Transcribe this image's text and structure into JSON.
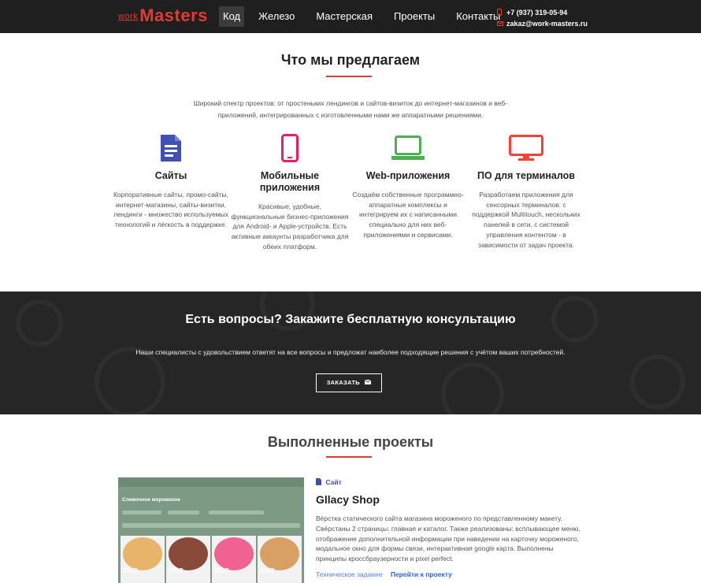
{
  "header": {
    "logo_small": "work",
    "logo_big": "Masters",
    "nav": [
      {
        "label": "Код",
        "active": true
      },
      {
        "label": "Железо"
      },
      {
        "label": "Мастерская"
      },
      {
        "label": "Проекты"
      },
      {
        "label": "Контакты"
      }
    ],
    "phone": "+7 (937) 319-05-94",
    "email": "zakaz@work-masters.ru"
  },
  "offer": {
    "title": "Что мы предлагаем",
    "intro": "Широкий спектр проектов: от простеньких лендингов и сайтов-визиток до интернет-магазинов и веб-приложений, интегрированных с изготовленными нами же аппаратными решениями.",
    "services": [
      {
        "icon": "document-icon",
        "color": "#3f51b5",
        "title": "Сайты",
        "text": "Корпоративные сайты, промо-сайты, интернет-магазины, сайты-визитки, лендинги - множество используемых технологий и лёгкость в поддержке."
      },
      {
        "icon": "smartphone-icon",
        "color": "#e91e63",
        "title": "Мобильные приложения",
        "text": "Красивые, удобные, функциональные бизнес-приложения для Android- и Apple-устройств. Есть активные аккаунты разработчика для обеих платформ."
      },
      {
        "icon": "laptop-icon",
        "color": "#4caf50",
        "title": "Web-приложения",
        "text": "Создаём собственные программно-аппаратные комплексы и интегрируем их с написанными специально для них веб-приложениями и сервисами."
      },
      {
        "icon": "monitor-icon",
        "color": "#f44336",
        "title": "ПО для терминалов",
        "text": "Разработаем приложения для сенсорных терминалов: с поддержкой Multitouch, нескольких панелей в сети, с системой управления контентом - в зависимости от задач проекта."
      }
    ]
  },
  "consult": {
    "title": "Есть вопросы? Закажите бесплатную консультацию",
    "text": "Наши специалисты с удовольствием ответят на все вопросы и предложат наиболее подходящие решения с учётом ваших потребностей.",
    "button": "ЗАКАЗАТЬ"
  },
  "projects": {
    "title": "Выполненные проекты",
    "item": {
      "screenshot_title": "Сливочное мороженое",
      "prices": [
        "310₽",
        "380₽",
        "355₽",
        "415₽"
      ],
      "type": "Сайт",
      "name": "Gllacy Shop",
      "description": "Вёрстка статического сайта магазина мороженого по представленному макету. Свёрстаны 2 страницы: главная и каталог. Также реализованы: всплывающее меню, отображение дополнительной информации при наведении на карточку мороженого, модальное окно для формы связи, интерактивная google карта. Выполнены принципы кроссбраузерности и pixel perfect.",
      "link_spec": "Техническое задание",
      "link_project": "Перейти к проекту"
    }
  }
}
